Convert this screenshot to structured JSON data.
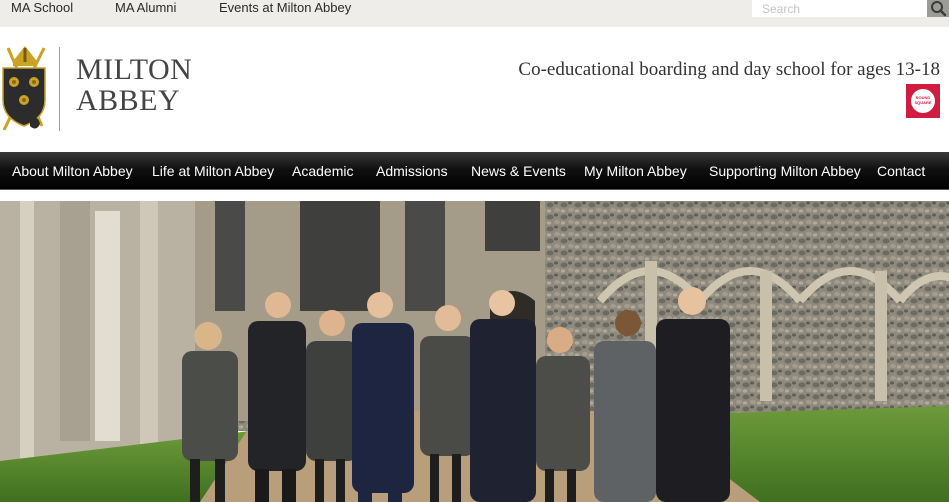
{
  "topbar": {
    "links": [
      "MA School",
      "MA Alumni",
      "Events at Milton Abbey"
    ],
    "search": {
      "placeholder": "Search",
      "icon": "search-icon"
    }
  },
  "header": {
    "logo_line1": "MILTON",
    "logo_line2": "ABBEY",
    "tagline": "Co-educational boarding and day school for ages 13-18",
    "badge_text": "ROUND SQUARE",
    "colors": {
      "gold": "#c9a227",
      "badge": "#d21c3f"
    }
  },
  "nav": {
    "items": [
      "About Milton Abbey",
      "Life at Milton Abbey",
      "Academic",
      "Admissions",
      "News & Events",
      "My Milton Abbey",
      "Supporting Milton Abbey",
      "Contact"
    ]
  }
}
